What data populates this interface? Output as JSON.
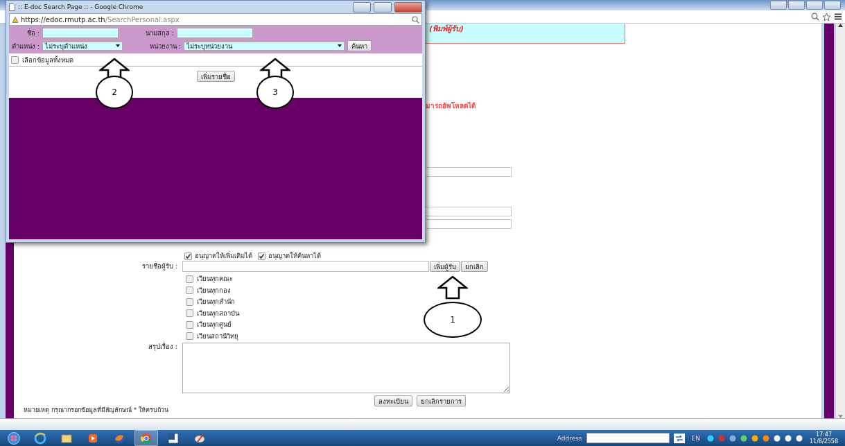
{
  "main_page": {
    "notice_text": "(พิมพ์ผู้รับ)",
    "upload_note": "มารถอัพโหลดได้",
    "permissions": [
      {
        "label": "อนุญาตให้เพิ่มเติมได้",
        "checked": true
      },
      {
        "label": "อนุญาตให้ค้นหาได้",
        "checked": true
      }
    ],
    "recipients": {
      "label": "รายชื่อผู้รับ :",
      "buttons": [
        "เพิ่มผู้รับ",
        "ยกเลิก"
      ]
    },
    "send_options": [
      {
        "label": "เวียนทุกคณะ",
        "checked": false
      },
      {
        "label": "เวียนทุกกอง",
        "checked": false
      },
      {
        "label": "เวียนทุกสำนัก",
        "checked": false
      },
      {
        "label": "เวียนทุกสถาบัน",
        "checked": false
      },
      {
        "label": "เวียนทุกศูนย์",
        "checked": false
      },
      {
        "label": "เวียนสถานีวิทยุ",
        "checked": false
      }
    ],
    "summary_label": "สรุปเรื่อง :",
    "buttons": [
      "ลงทะเบียน",
      "ยกเลิกรายการ"
    ],
    "footnote": "หมายเหตุ กรุณากรอกข้อมูลที่มีสัญลักษณ์ * ให้ครบถ้วน"
  },
  "popup": {
    "title": ":: E-doc Search Page :: - Google Chrome",
    "url_host": "https://edoc.rmutp.ac.th",
    "url_path": "/SearchPersonal.aspx",
    "fields": [
      {
        "label": "ชื่อ :"
      },
      {
        "label": "นามสกุล :"
      }
    ],
    "selects": [
      {
        "label": "ตำแหน่ง :",
        "value": "ไม่ระบุตำแหน่ง"
      },
      {
        "label": "หน่วยงาน :",
        "value": "ไม่ระบุหน่วยงาน"
      }
    ],
    "search_button": "ค้นหา",
    "select_all": {
      "label": "เลือกข้อมูลทั้งหมด",
      "checked": false
    },
    "add_button": "เพิ่มรายชื่อ"
  },
  "annotations": [
    {
      "number": "1"
    },
    {
      "number": "2"
    },
    {
      "number": "3"
    }
  ],
  "taskbar": {
    "address_label": "Address",
    "language": "EN",
    "time": "17:47",
    "date": "11/8/2558"
  }
}
